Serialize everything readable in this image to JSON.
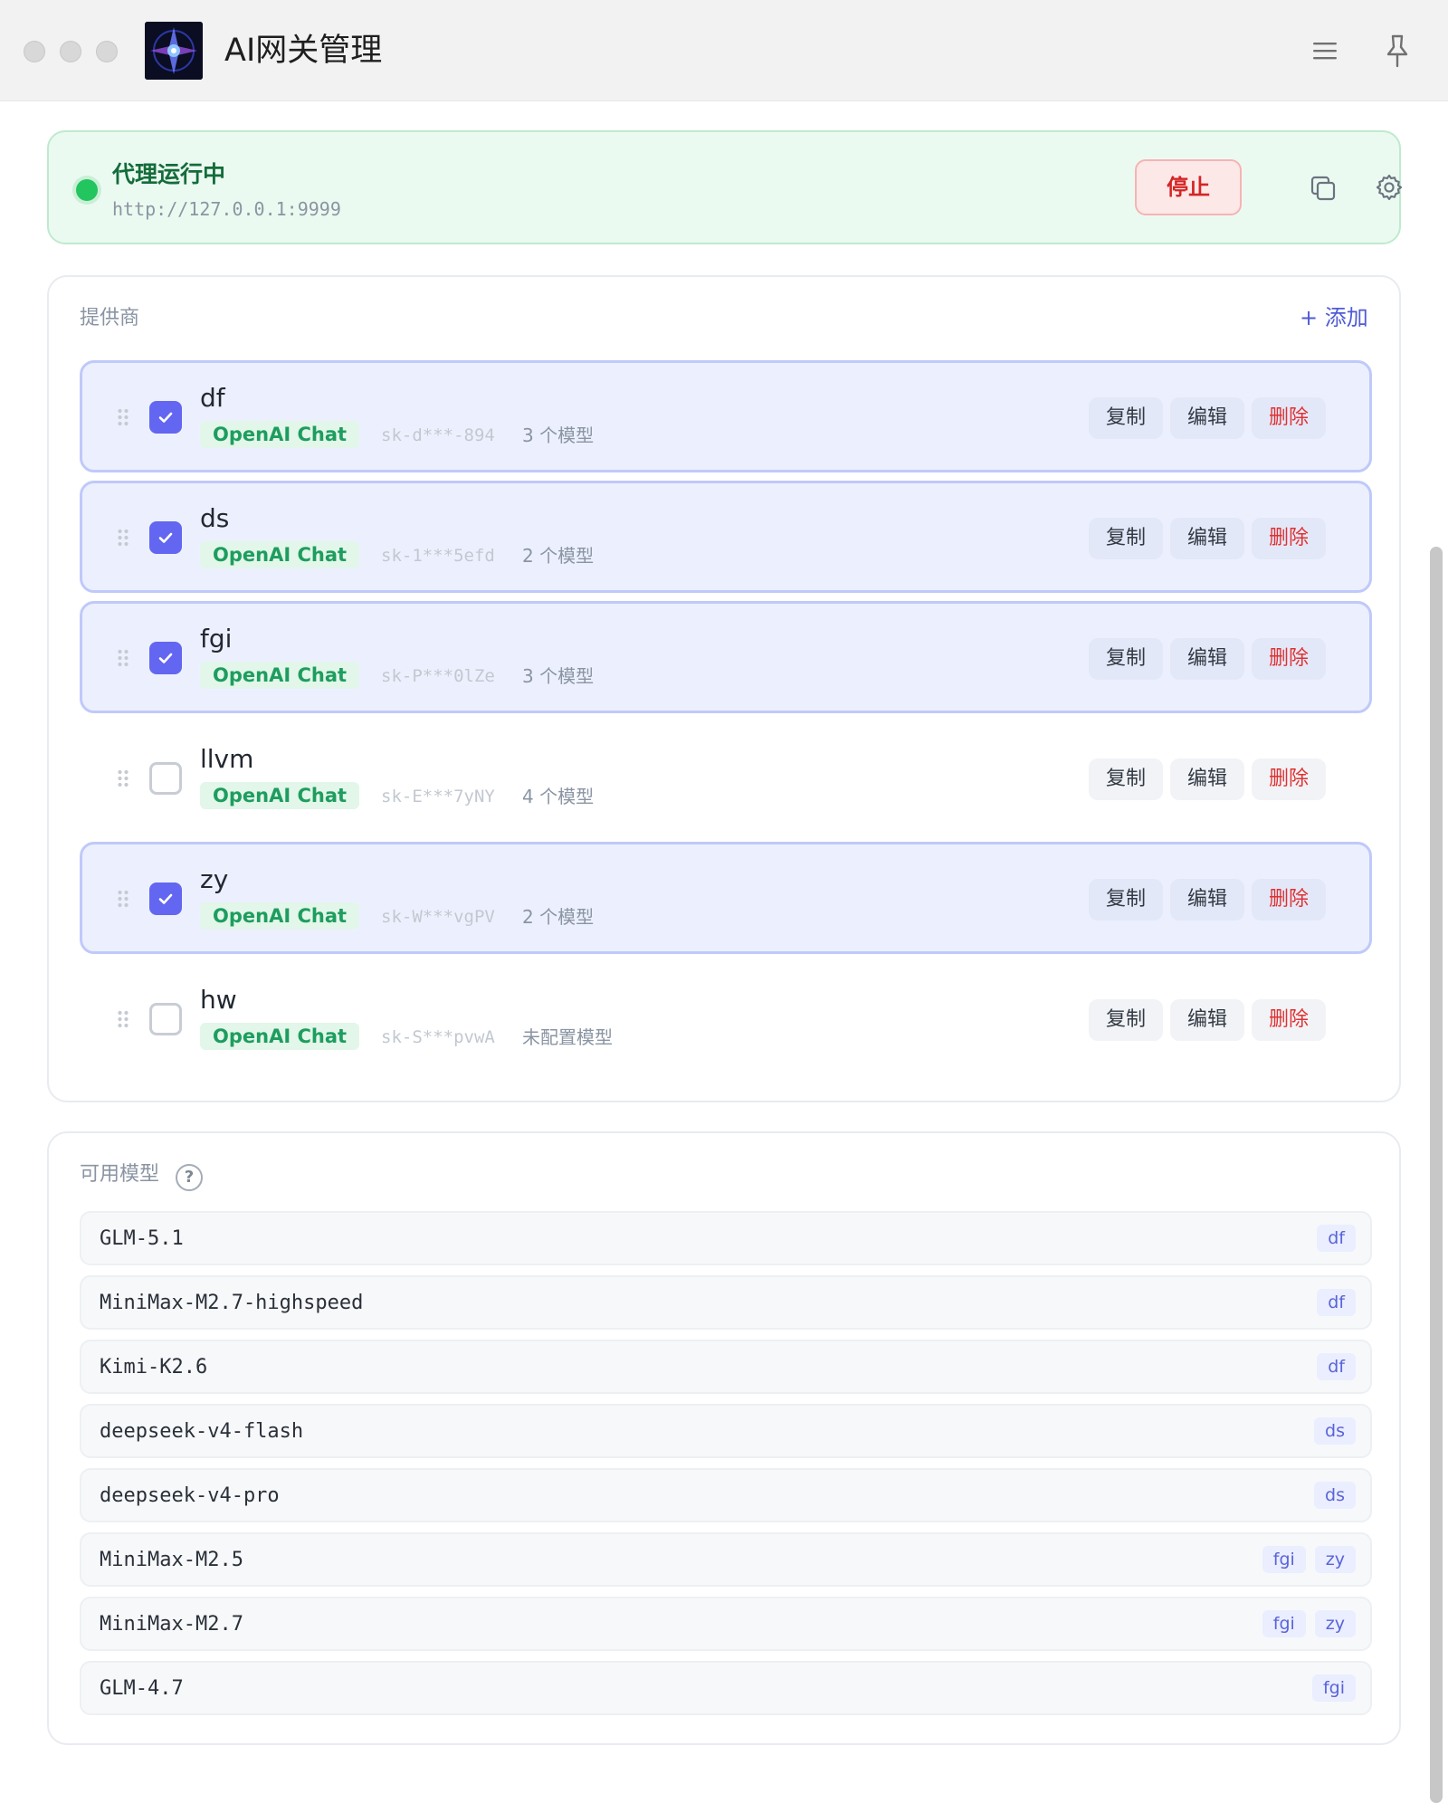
{
  "window": {
    "title": "AI网关管理",
    "icons": {
      "menu": "hamburger-menu-icon",
      "pin": "pin-icon",
      "logo": "app-logo"
    }
  },
  "status": {
    "title": "代理运行中",
    "url": "http://127.0.0.1:9999",
    "stop_label": "停止",
    "state": "running",
    "icons": {
      "copy": "copy-icon",
      "settings": "gear-icon"
    },
    "colors": {
      "accent": "#22c55e",
      "stop": "#d32525"
    }
  },
  "providers": {
    "label": "提供商",
    "add_label": "+ 添加",
    "actions": {
      "copy": "复制",
      "edit": "编辑",
      "delete": "删除"
    },
    "items": [
      {
        "name": "df",
        "type": "OpenAI Chat",
        "key": "sk-d***-894",
        "models": "3 个模型",
        "enabled": true
      },
      {
        "name": "ds",
        "type": "OpenAI Chat",
        "key": "sk-1***5efd",
        "models": "2 个模型",
        "enabled": true
      },
      {
        "name": "fgi",
        "type": "OpenAI Chat",
        "key": "sk-P***0lZe",
        "models": "3 个模型",
        "enabled": true
      },
      {
        "name": "llvm",
        "type": "OpenAI Chat",
        "key": "sk-E***7yNY",
        "models": "4 个模型",
        "enabled": false
      },
      {
        "name": "zy",
        "type": "OpenAI Chat",
        "key": "sk-W***vgPV",
        "models": "2 个模型",
        "enabled": true
      },
      {
        "name": "hw",
        "type": "OpenAI Chat",
        "key": "sk-S***pvwA",
        "models": "未配置模型",
        "enabled": false
      }
    ]
  },
  "models": {
    "label": "可用模型",
    "help": "?",
    "items": [
      {
        "name": "GLM-5.1",
        "providers": [
          "df"
        ]
      },
      {
        "name": "MiniMax-M2.7-highspeed",
        "providers": [
          "df"
        ]
      },
      {
        "name": "Kimi-K2.6",
        "providers": [
          "df"
        ]
      },
      {
        "name": "deepseek-v4-flash",
        "providers": [
          "ds"
        ]
      },
      {
        "name": "deepseek-v4-pro",
        "providers": [
          "ds"
        ]
      },
      {
        "name": "MiniMax-M2.5",
        "providers": [
          "fgi",
          "zy"
        ]
      },
      {
        "name": "MiniMax-M2.7",
        "providers": [
          "fgi",
          "zy"
        ]
      },
      {
        "name": "GLM-4.7",
        "providers": [
          "fgi"
        ]
      }
    ]
  }
}
